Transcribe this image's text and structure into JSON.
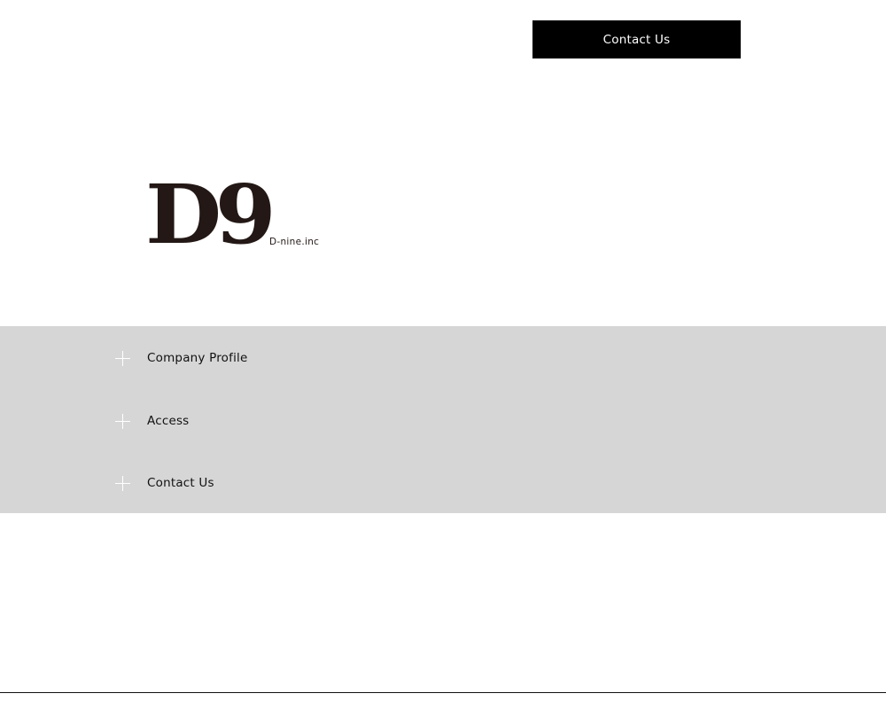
{
  "header": {
    "contact_button_label": "Contact Us"
  },
  "logo": {
    "mark": "D9",
    "subtitle": "D-nine.inc"
  },
  "menu": {
    "items": [
      {
        "label": "Company Profile",
        "icon": "plus-icon"
      },
      {
        "label": "Access",
        "icon": "plus-icon"
      },
      {
        "label": "Contact Us",
        "icon": "plus-icon"
      }
    ]
  },
  "colors": {
    "button_bg": "#000000",
    "button_text": "#ffffff",
    "menu_band_bg": "#d6d6d6",
    "logo_color": "#231815",
    "icon_color": "#ffffff"
  }
}
